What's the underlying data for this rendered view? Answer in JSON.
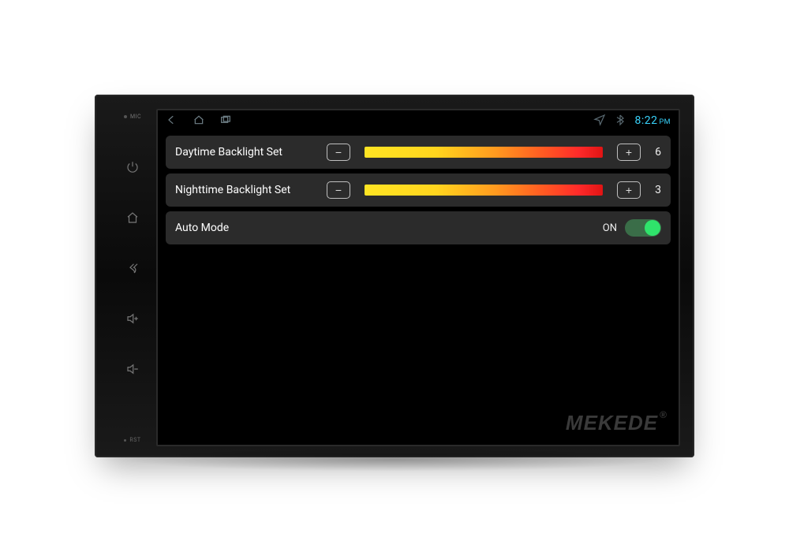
{
  "hardware": {
    "mic_label": "MIC",
    "rst_label": "RST",
    "brand": "MEKEDE",
    "brand_mark": "®"
  },
  "statusbar": {
    "time": "8:22",
    "time_suffix": "PM"
  },
  "settings": {
    "daytime": {
      "label": "Daytime Backlight Set",
      "value": "6"
    },
    "nighttime": {
      "label": "Nighttime Backlight Set",
      "value": "3"
    },
    "automode": {
      "label": "Auto Mode",
      "state": "ON"
    }
  }
}
